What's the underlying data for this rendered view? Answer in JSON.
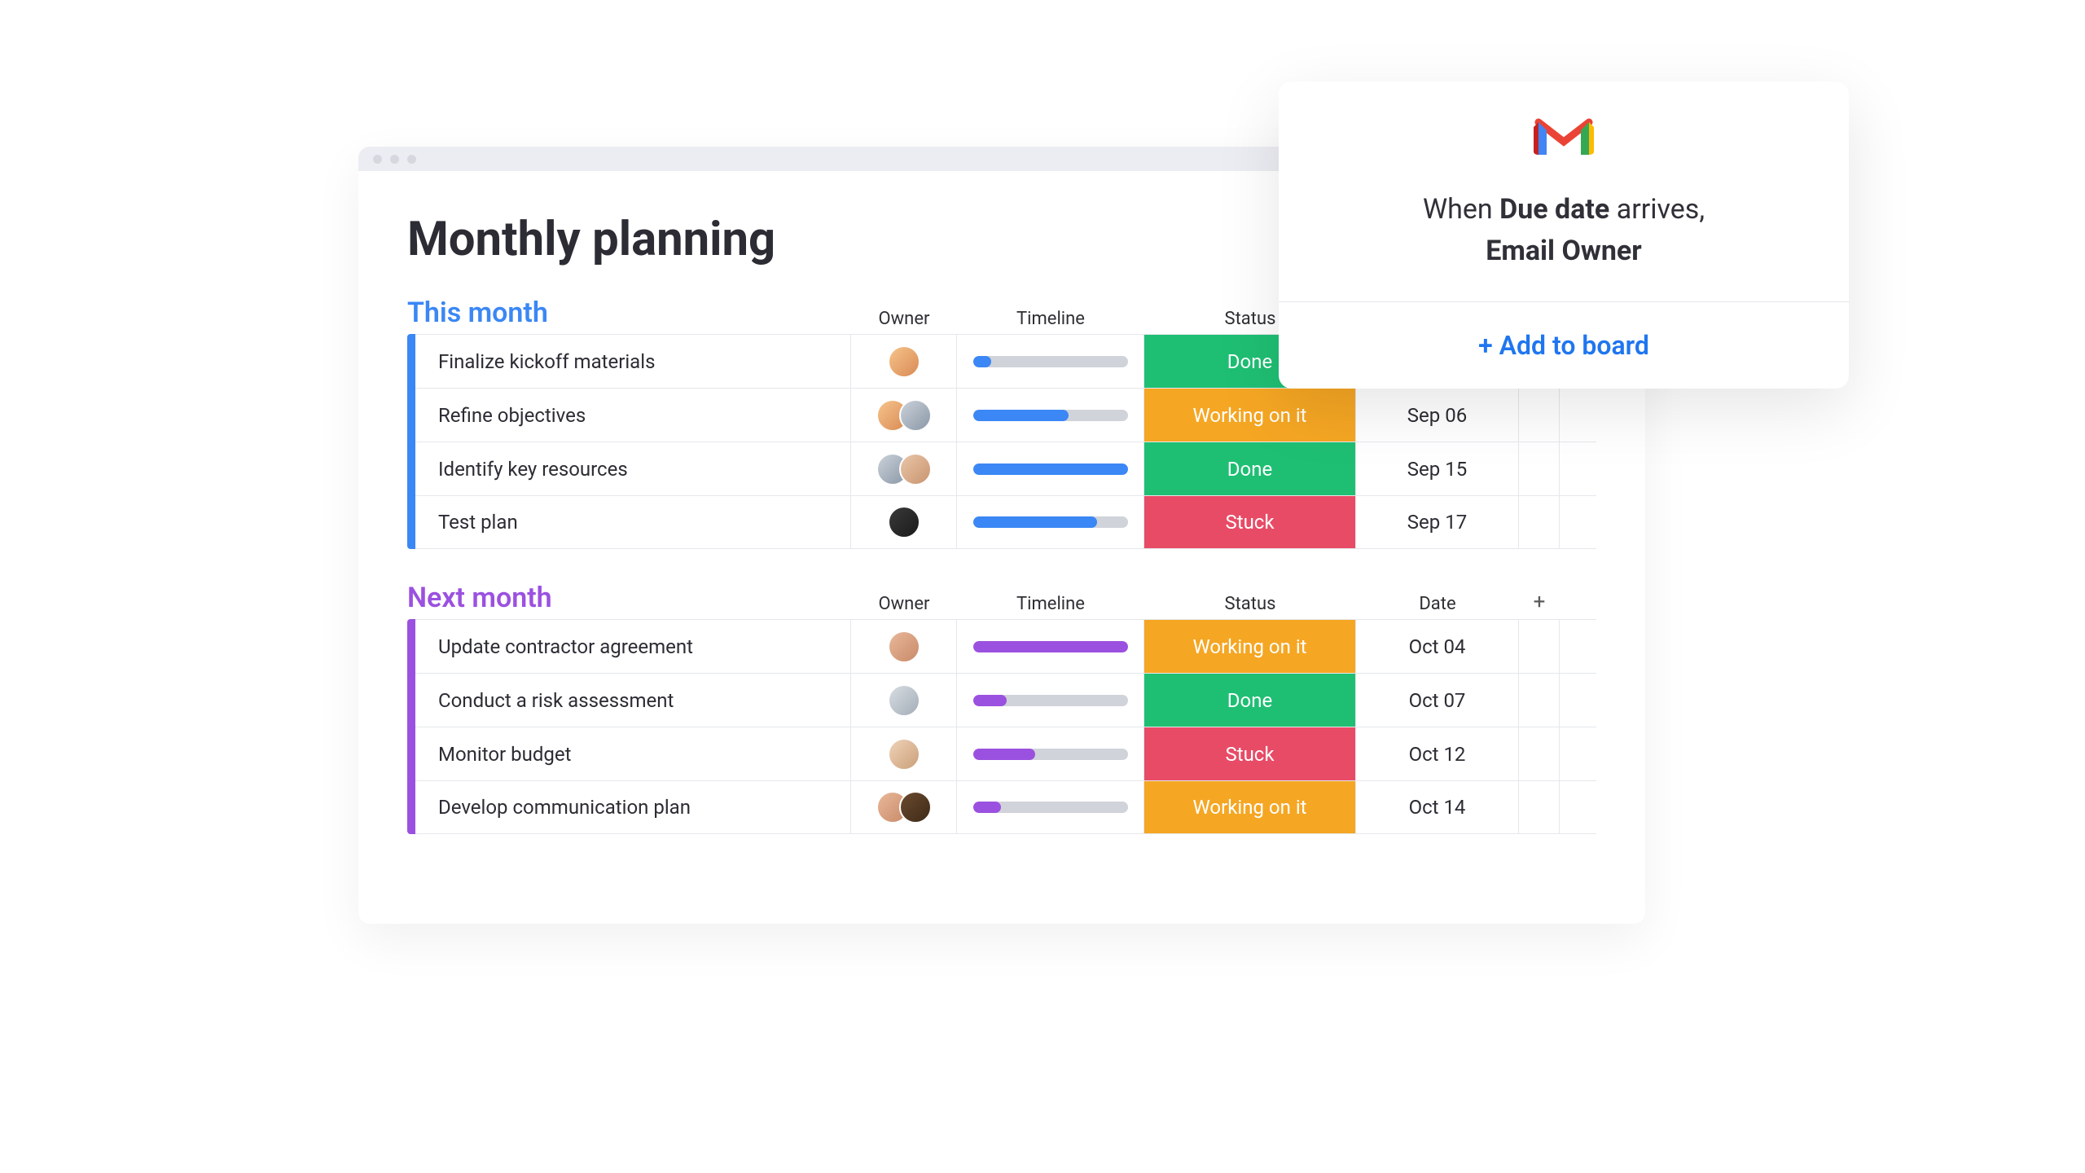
{
  "page": {
    "title": "Monthly planning"
  },
  "columns": {
    "owner": "Owner",
    "timeline": "Timeline",
    "status": "Status",
    "date": "Date"
  },
  "status_labels": {
    "done": "Done",
    "working": "Working on it",
    "stuck": "Stuck"
  },
  "colors": {
    "blue": "#3b87f5",
    "purple": "#9b51e0",
    "done": "#1fbf73",
    "working": "#f5a623",
    "stuck": "#e84b66"
  },
  "groups": [
    {
      "id": "this-month",
      "title": "This month",
      "accent": "blue",
      "rows": [
        {
          "name": "Finalize kickoff materials",
          "owners": [
            "a1"
          ],
          "progress": 12,
          "status": "done",
          "date": ""
        },
        {
          "name": "Refine objectives",
          "owners": [
            "a1",
            "a2"
          ],
          "progress": 62,
          "status": "working",
          "date": "Sep 06"
        },
        {
          "name": "Identify key resources",
          "owners": [
            "a2",
            "a3"
          ],
          "progress": 100,
          "status": "done",
          "date": "Sep 15"
        },
        {
          "name": "Test plan",
          "owners": [
            "a4"
          ],
          "progress": 80,
          "status": "stuck",
          "date": "Sep 17"
        }
      ]
    },
    {
      "id": "next-month",
      "title": "Next month",
      "accent": "purple",
      "rows": [
        {
          "name": "Update contractor agreement",
          "owners": [
            "a5"
          ],
          "progress": 100,
          "status": "working",
          "date": "Oct 04"
        },
        {
          "name": "Conduct a risk assessment",
          "owners": [
            "a6"
          ],
          "progress": 22,
          "status": "done",
          "date": "Oct 07"
        },
        {
          "name": "Monitor budget",
          "owners": [
            "a7"
          ],
          "progress": 40,
          "status": "stuck",
          "date": "Oct 12"
        },
        {
          "name": "Develop communication plan",
          "owners": [
            "a5",
            "a8"
          ],
          "progress": 18,
          "status": "working",
          "date": "Oct 14"
        }
      ]
    }
  ],
  "automation": {
    "line1_pre": "When ",
    "line1_bold": "Due date",
    "line1_post": " arrives,",
    "line2_bold": "Email Owner",
    "action": "+ Add to board"
  }
}
